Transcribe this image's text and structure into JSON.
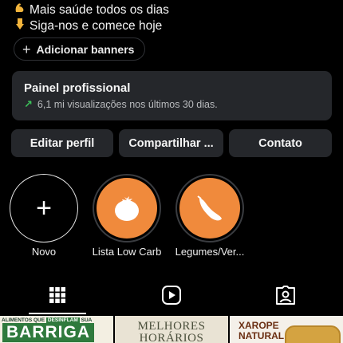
{
  "bio": {
    "line1": "Mais saúde todos os dias",
    "line2": "Siga-nos e comece hoje",
    "icon1": "flexed-biceps-emoji",
    "icon2": "pointing-down-emoji"
  },
  "banners": {
    "label": "Adicionar banners"
  },
  "dashboard": {
    "title": "Painel profissional",
    "subtitle": "6,1 mi visualizações nos últimos 30 dias.",
    "trend_color": "#3cc35a"
  },
  "actions": [
    {
      "label": "Editar perfil"
    },
    {
      "label": "Compartilhar ..."
    },
    {
      "label": "Contato"
    }
  ],
  "highlights": [
    {
      "label": "Novo",
      "icon": "plus-icon"
    },
    {
      "label": "Lista Low Carb",
      "icon": "tomato-icon"
    },
    {
      "label": "Legumes/Ver...",
      "icon": "vegetable-icon"
    }
  ],
  "tabs": [
    {
      "name": "grid",
      "icon": "grid-icon",
      "active": true
    },
    {
      "name": "reels",
      "icon": "reels-icon",
      "active": false
    },
    {
      "name": "tagged",
      "icon": "tagged-person-icon",
      "active": false
    }
  ],
  "posts": [
    {
      "top": "ALIMENTOS QUE",
      "highlight": "DESINFLAM",
      "top_end": "SUA",
      "big": "BARRIGA"
    },
    {
      "line1": "MELHORES",
      "line2": "HORÁRIOS"
    },
    {
      "line1": "XAROPE",
      "line2": "NATURAL"
    }
  ],
  "colors": {
    "background": "#000000",
    "panel": "#25272b",
    "highlight_fill": "#f08a3c"
  }
}
